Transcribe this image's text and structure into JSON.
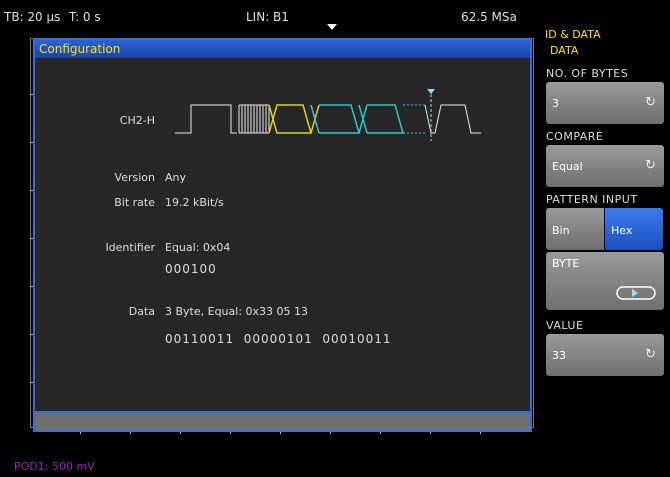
{
  "status": {
    "timebase": "TB: 20 µs",
    "trigger": "T: 0 s",
    "bus": "LIN: B1",
    "sample_rate": "62.5 MSa"
  },
  "dialog": {
    "title": "Configuration",
    "signal_label": "CH2-H",
    "version_label": "Version",
    "version_value": "Any",
    "bitrate_label": "Bit rate",
    "bitrate_value": "19.2 kBit/s",
    "identifier_label": "Identifier",
    "identifier_value": "Equal: 0x04",
    "identifier_bits": "000100",
    "data_label": "Data",
    "data_value": "3 Byte, Equal: 0x33 05 13",
    "data_bits": "00110011  00000101  00010011"
  },
  "footer": {
    "probe": "POD1: 500 mV"
  },
  "panel": {
    "title": "ID & DATA",
    "subtitle": "DATA",
    "num_bytes_label": "NO. OF BYTES",
    "num_bytes_value": "3",
    "compare_label": "COMPARE",
    "compare_value": "Equal",
    "pattern_label": "PATTERN INPUT",
    "pattern_bin": "Bin",
    "pattern_hex": "Hex",
    "byte_label": "BYTE",
    "value_label": "VALUE",
    "value_value": "33"
  },
  "colors": {
    "accent_blue": "#2f6fe0",
    "title_yellow": "#ffe300",
    "probe_purple": "#a020c0",
    "wave_yellow": "#e0d020",
    "wave_cyan": "#30c8c8"
  },
  "icons": {
    "rotary": "rotary-knob-icon",
    "byte_selector": "byte-toggle-icon",
    "trigger": "trigger-marker-icon"
  }
}
